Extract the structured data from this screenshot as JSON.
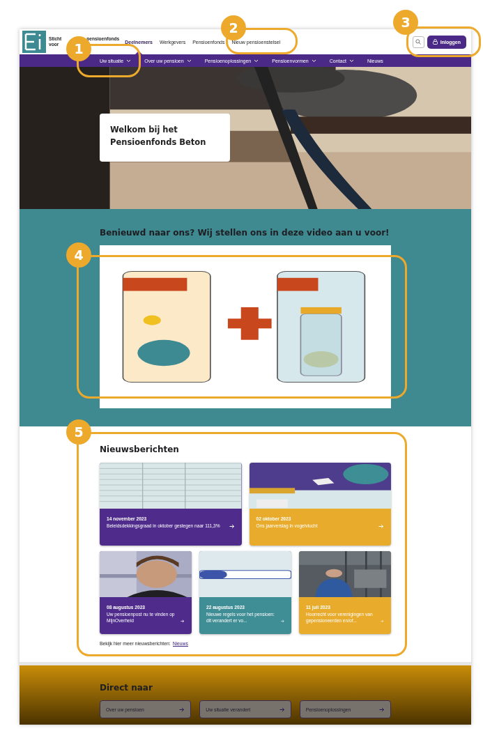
{
  "header": {
    "logo_lines": [
      [
        "Sticht",
        "pensioenfonds"
      ],
      [
        "voor"
      ]
    ],
    "nav": [
      {
        "label": "Deelnemers",
        "selected": true
      },
      {
        "label": "Werkgevers",
        "selected": false
      },
      {
        "label": "Pensioenfonds",
        "selected": false
      },
      {
        "label": "Nieuw pensioenstelsel",
        "selected": false
      }
    ],
    "login_button": "Inloggen"
  },
  "subnav": [
    {
      "label": "Uw situatie",
      "has_menu": true
    },
    {
      "label": "Over uw pensioen",
      "has_menu": true
    },
    {
      "label": "Pensioenoplossingen",
      "has_menu": true
    },
    {
      "label": "Pensioenvormen",
      "has_menu": true
    },
    {
      "label": "Contact",
      "has_menu": true
    },
    {
      "label": "Nieuws",
      "has_menu": false
    }
  ],
  "hero": {
    "kind": "picture",
    "title": "Welkom bij het Pensioenfonds Beton"
  },
  "video_section": {
    "heading": "Benieuwd naar ons? Wij stellen ons in deze video aan u voor!"
  },
  "news": {
    "heading": "Nieuwsberichten",
    "items": [
      {
        "date": "14 november 2023",
        "title": "Beleidsdekkingsgraad in oktober gestegen naar 111,3%",
        "color": "#4f2c8c"
      },
      {
        "date": "02 oktober 2023",
        "title": "Ons jaarverslag in vogelvlucht",
        "color": "#e8ab2c"
      },
      {
        "date": "08 augustus 2023",
        "title": "Uw pensioenpost nu te vinden op MijnOverheid",
        "color": "#4f2c8c"
      },
      {
        "date": "22 augustus 2023",
        "title": "Nieuwe regels voor het pensioen: dit verandert er vo...",
        "color": "#3f8d95"
      },
      {
        "date": "11 juli 2023",
        "title": "Hoorrecht voor verenigingen van gepensioneerden en/of...",
        "color": "#e8ab2c"
      }
    ],
    "more_text": "Bekijk hier meer nieuwsberichten:",
    "more_link": "Nieuws"
  },
  "direct": {
    "heading": "Direct naar",
    "buttons": [
      "Over uw pensioen",
      "Uw situatie verandert",
      "Pensioenoplossingen"
    ]
  },
  "annotations": [
    {
      "number": "1"
    },
    {
      "number": "2"
    },
    {
      "number": "3"
    },
    {
      "number": "4"
    },
    {
      "number": "5"
    }
  ]
}
